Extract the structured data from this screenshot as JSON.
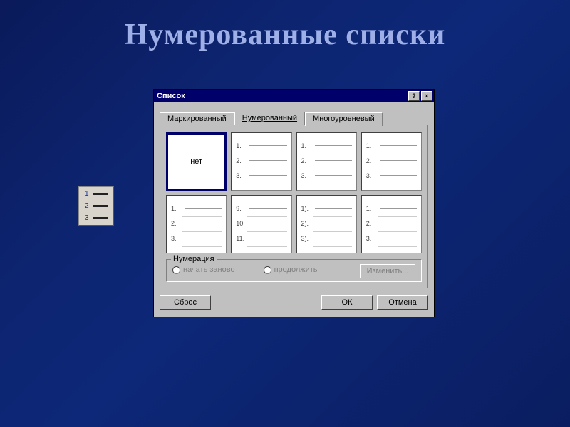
{
  "slide": {
    "title": "Нумерованные списки"
  },
  "dialog": {
    "title": "Список",
    "help_btn": "?",
    "close_btn": "×",
    "tabs": {
      "bulleted": "Маркированный",
      "numbered": "Нумерованный",
      "multilevel": "Многоуровневый"
    },
    "options": {
      "none": "нет",
      "r0c1": [
        "1.",
        "2.",
        "3."
      ],
      "r0c2": [
        "1.",
        "2.",
        "3."
      ],
      "r0c3": [
        "1.",
        "2.",
        "3."
      ],
      "r1c0": [
        "1.",
        "2.",
        "3."
      ],
      "r1c1": [
        "9.",
        "10.",
        "11."
      ],
      "r1c2": [
        "1).",
        "2).",
        "3)."
      ],
      "r1c3": [
        "1.",
        "2.",
        "3."
      ]
    },
    "group": {
      "title": "Нумерация",
      "restart": "начать заново",
      "continue": "продолжить",
      "change": "Изменить..."
    },
    "buttons": {
      "reset": "Сброс",
      "ok": "ОК",
      "cancel": "Отмена"
    }
  }
}
